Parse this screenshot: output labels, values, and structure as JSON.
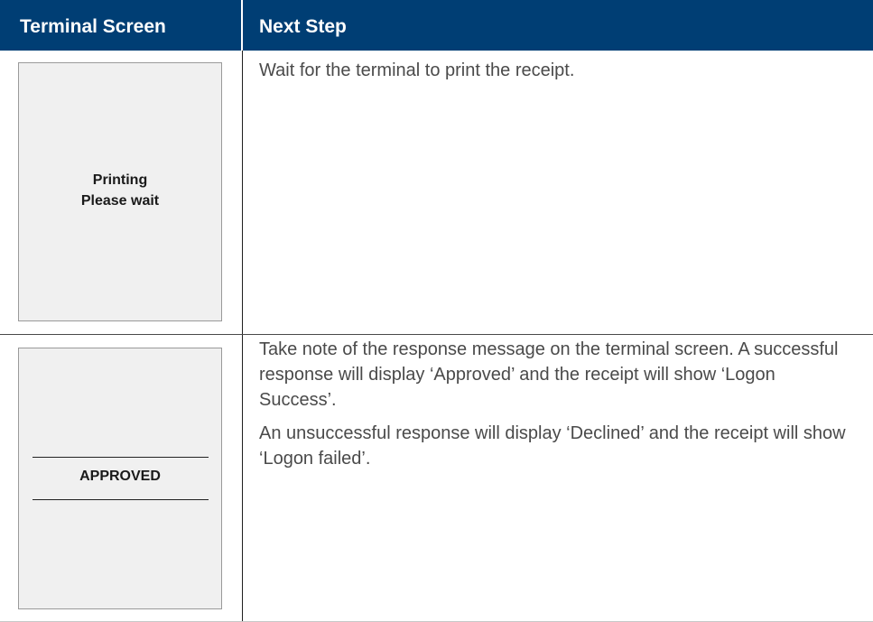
{
  "header": {
    "col1": "Terminal Screen",
    "col2": "Next Step"
  },
  "rows": [
    {
      "screen_lines": [
        "Printing",
        "Please wait"
      ],
      "step_paragraphs": [
        "Wait for the terminal to print the receipt."
      ]
    },
    {
      "screen_lines": [
        "APPROVED"
      ],
      "step_paragraphs": [
        "Take note of the response message on the terminal screen. A successful response will display ‘Approved’ and the receipt will show ‘Logon Success’.",
        "An unsuccessful response will display ‘Declined’ and the receipt will show ‘Logon failed’."
      ]
    }
  ],
  "colors": {
    "header_background": "#003e74",
    "header_text": "#ffffff",
    "screen_background": "#f0f0f0",
    "body_text": "#4a4a4a"
  }
}
